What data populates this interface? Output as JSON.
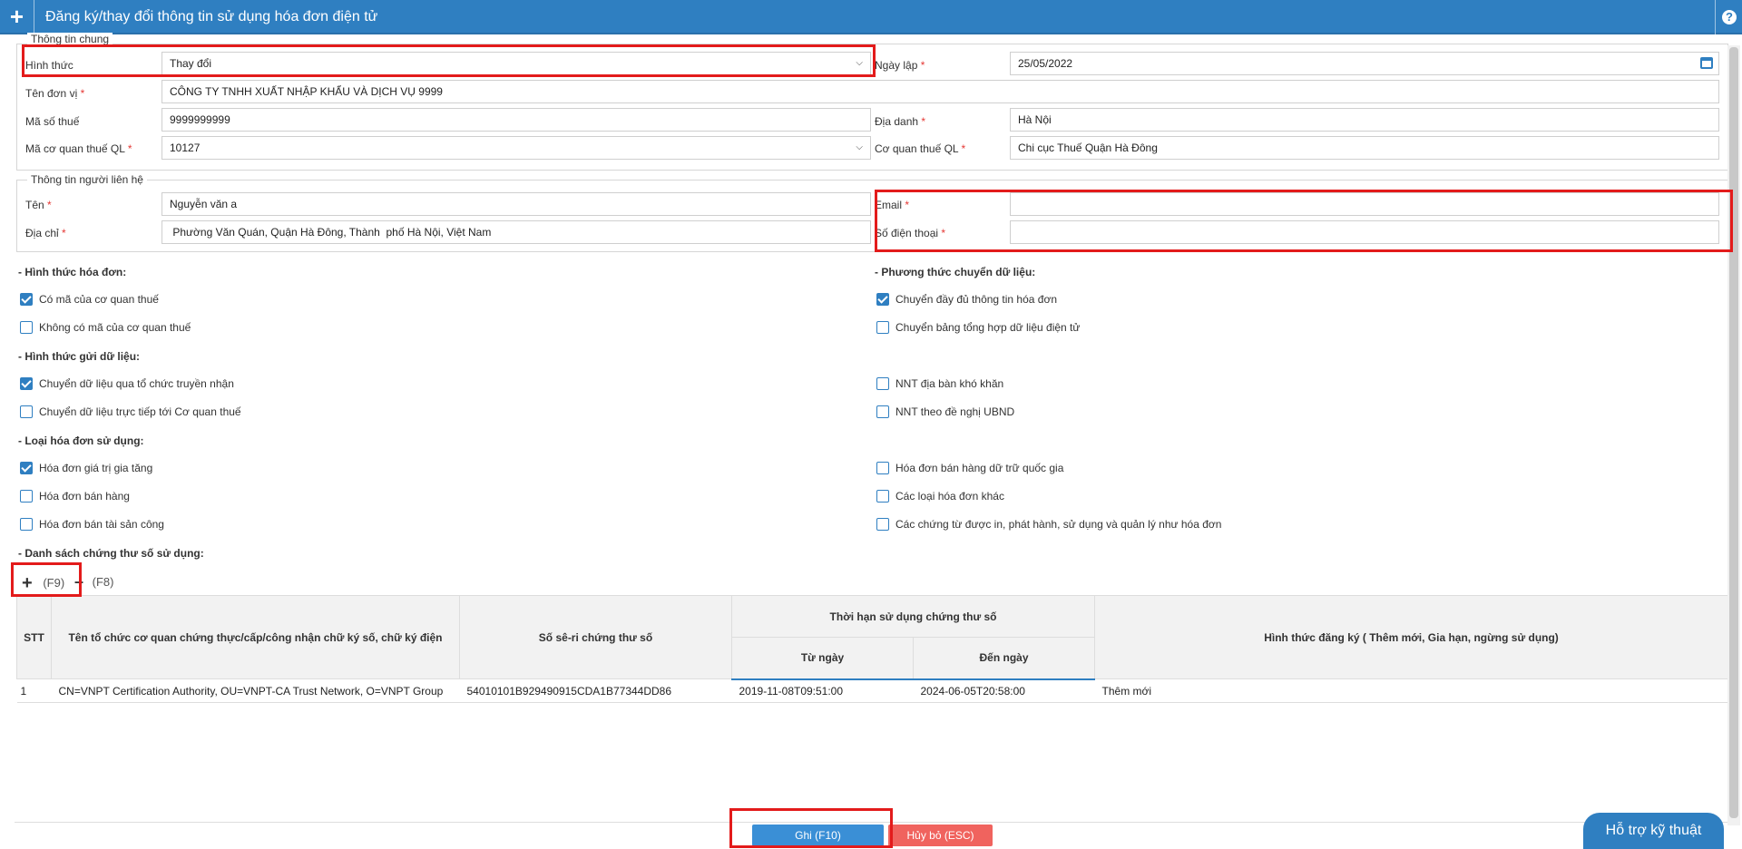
{
  "title": "Đăng ký/thay đổi thông tin sử dụng hóa đơn điện tử",
  "help_icon": "?",
  "general": {
    "legend": "Thông tin chung",
    "hinh_thuc_label": "Hình thức",
    "hinh_thuc_value": "Thay đổi",
    "ngay_lap_label": "Ngày lập",
    "ngay_lap_value": "25/05/2022",
    "ten_don_vi_label": "Tên đơn vị",
    "ten_don_vi_value": "CÔNG TY TNHH XUẤT NHẬP KHẨU VÀ DỊCH VỤ 9999",
    "mst_label": "Mã số thuế",
    "mst_value": "9999999999",
    "dia_danh_label": "Địa danh",
    "dia_danh_value": "Hà Nội",
    "ma_cqt_label": "Mã cơ quan thuế QL",
    "ma_cqt_value": "10127",
    "cqt_label": "Cơ quan thuế QL",
    "cqt_value": "Chi cục Thuế Quận Hà Đông"
  },
  "contact": {
    "legend": "Thông tin người liên hệ",
    "ten_label": "Tên",
    "ten_value": "Nguyễn văn a",
    "email_label": "Email",
    "email_value": "",
    "dia_chi_label": "Địa chỉ",
    "dia_chi_value": " Phường Văn Quán, Quận Hà Đông, Thành  phố Hà Nội, Việt Nam",
    "sdt_label": "Số điện thoại",
    "sdt_value": ""
  },
  "sections": {
    "hinh_thuc_hd": "- Hình thức hóa đơn:",
    "phuong_thuc": "- Phương thức chuyển dữ liệu:",
    "hinh_thuc_gui": "- Hình thức gửi dữ liệu:",
    "loai_hd": "- Loại hóa đơn sử dụng:",
    "ds_cts": "- Danh sách chứng thư số sử dụng:"
  },
  "options": {
    "co_ma": "Có mã của cơ quan thuế",
    "khong_ma": "Không có mã của cơ quan thuế",
    "chuyen_day_du": "Chuyển đầy đủ thông tin hóa đơn",
    "chuyen_bang_th": "Chuyển bảng tổng hợp dữ liệu điện tử",
    "qua_to_chuc": "Chuyển dữ liệu qua tổ chức truyền nhận",
    "truc_tiep": "Chuyển dữ liệu trực tiếp tới Cơ quan thuế",
    "nnt_kho_khan": "NNT địa bàn khó khăn",
    "nnt_ubnd": "NNT theo đề nghị UBND",
    "gtgt": "Hóa đơn giá trị gia tăng",
    "ban_hang": "Hóa đơn bán hàng",
    "tai_san_cong": "Hóa đơn bán tài sản công",
    "du_tru": "Hóa đơn bán hàng dữ trữ quốc gia",
    "khac": "Các loại hóa đơn khác",
    "chung_tu": "Các chứng từ được in, phát hành, sử dụng và quản lý như hóa đơn"
  },
  "toolbar": {
    "add_key": "(F9)",
    "remove_key": "(F8)"
  },
  "table": {
    "headers": {
      "stt": "STT",
      "ten_to_chuc": "Tên tổ chức cơ quan chứng thực/cấp/công nhận chữ ký số, chữ ký điện",
      "so_seri": "Số sê-ri chứng thư số",
      "thoi_han": "Thời hạn sử dụng chứng thư số",
      "tu_ngay": "Từ ngày",
      "den_ngay": "Đến ngày",
      "hinh_thuc_dk": "Hình thức đăng ký ( Thêm mới, Gia hạn, ngừng sử dụng)"
    },
    "rows": [
      {
        "stt": "1",
        "ten": "CN=VNPT Certification Authority, OU=VNPT-CA Trust Network, O=VNPT Group",
        "seri": "54010101B929490915CDA1B77344DD86",
        "tu": "2019-11-08T09:51:00",
        "den": "2024-06-05T20:58:00",
        "hinh_thuc": "Thêm mới"
      }
    ]
  },
  "buttons": {
    "save": "Ghi (F10)",
    "cancel": "Hủy bỏ (ESC)"
  },
  "support": "Hỗ trợ kỹ thuật",
  "colors": {
    "primary": "#2f7fc1",
    "highlight": "#e31b1b",
    "cancel": "#f0635e"
  }
}
